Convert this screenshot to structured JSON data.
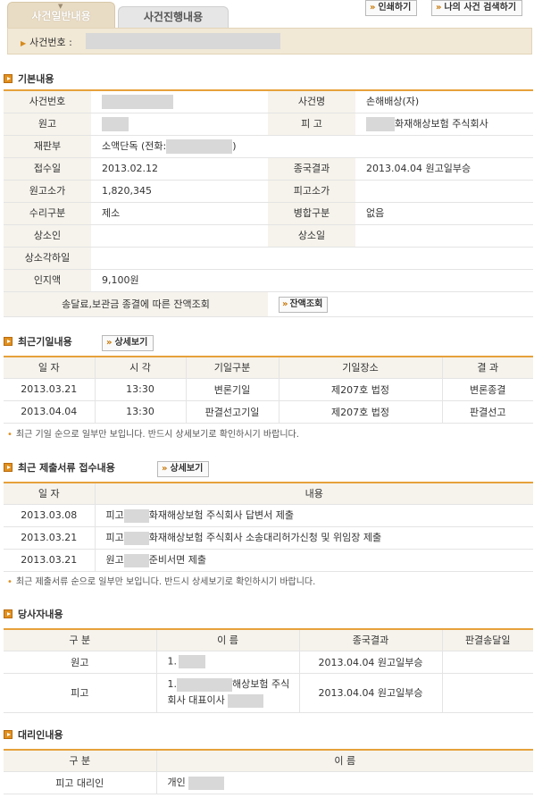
{
  "tabs": {
    "active": "사건일반내용",
    "inactive": "사건진행내용"
  },
  "top_buttons": {
    "print": "인쇄하기",
    "my_case_search": "나의 사건 검색하기"
  },
  "case_bar": {
    "label": "사건번호 :"
  },
  "basic": {
    "title": "기본내용",
    "case_no_label": "사건번호",
    "case_name_label": "사건명",
    "case_name": "손해배상(자)",
    "plaintiff_label": "원고",
    "defendant_label": "피 고",
    "defendant_value": "화재해상보험 주식회사",
    "division_label": "재판부",
    "division_value_prefix": "소액단독 (전화:",
    "division_value_suffix": ")",
    "filing_label": "접수일",
    "filing_date": "2013.02.12",
    "result_label": "종국결과",
    "result_value": "2013.04.04 원고일부승",
    "plaintiff_claim_label": "원고소가",
    "plaintiff_claim": "1,820,345",
    "defendant_claim_label": "피고소가",
    "receipt_label": "수리구분",
    "receipt_value": "제소",
    "merge_label": "병합구분",
    "merge_value": "없음",
    "appellant_label": "상소인",
    "appeal_date_label": "상소일",
    "appeal_dismiss_label": "상소각하일",
    "stamp_label": "인지액",
    "stamp_value": "9,100원",
    "balance_label": "송달료,보관금 종결에 따른 잔액조회",
    "balance_button": "잔액조회"
  },
  "hearings": {
    "title": "최근기일내용",
    "detail_button": "상세보기",
    "headers": [
      "일 자",
      "시 각",
      "기일구분",
      "기일장소",
      "결 과"
    ],
    "rows": [
      [
        "2013.03.21",
        "13:30",
        "변론기일",
        "제207호 법정",
        "변론종결"
      ],
      [
        "2013.04.04",
        "13:30",
        "판결선고기일",
        "제207호 법정",
        "판결선고"
      ]
    ],
    "note": "최근 기일 순으로 일부만 보입니다. 반드시 상세보기로 확인하시기 바랍니다."
  },
  "documents": {
    "title": "최근 제출서류 접수내용",
    "detail_button": "상세보기",
    "headers": [
      "일 자",
      "내용"
    ],
    "rows": [
      {
        "date": "2013.03.08",
        "prefix": "피고",
        "text": "화재해상보험 주식회사 답변서 제출"
      },
      {
        "date": "2013.03.21",
        "prefix": "피고",
        "text": "화재해상보험 주식회사 소송대리허가신청 및 위임장 제출"
      },
      {
        "date": "2013.03.21",
        "prefix": "원고",
        "text": "준비서면 제출"
      }
    ],
    "note": "최근 제출서류 순으로 일부만 보입니다. 반드시 상세보기로 확인하시기 바랍니다."
  },
  "parties": {
    "title": "당사자내용",
    "headers": [
      "구 분",
      "이 름",
      "종국결과",
      "판결송달일"
    ],
    "rows": [
      {
        "kind": "원고",
        "name_prefix": "1.",
        "name_suffix": "",
        "result": "2013.04.04 원고일부승"
      },
      {
        "kind": "피고",
        "name_prefix": "1.",
        "name_line1_suffix": "해상보험 주식",
        "name_line2": "회사 대표이사",
        "result": "2013.04.04 원고일부승"
      }
    ]
  },
  "agents": {
    "title": "대리인내용",
    "headers": [
      "구 분",
      "이 름"
    ],
    "rows": [
      {
        "kind": "피고 대리인",
        "name_prefix": "개인"
      }
    ]
  },
  "colors": {
    "accent": "#e7a13b",
    "label_bg": "#f6f3ec",
    "mask": "#d8d8d8"
  }
}
